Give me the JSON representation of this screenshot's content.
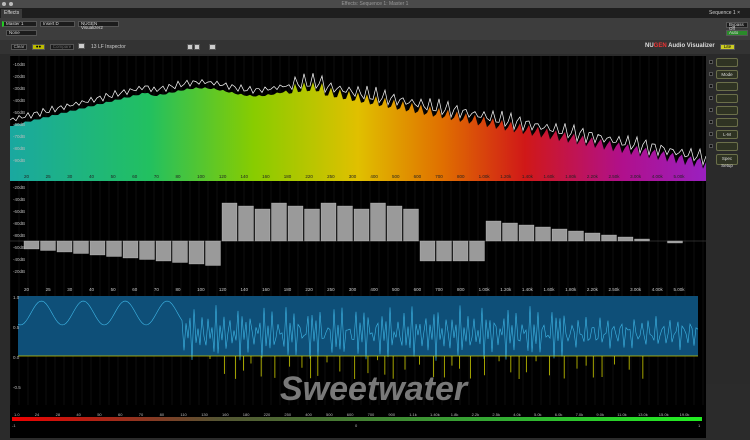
{
  "window": {
    "title": "Effects: Sequence 1: Master 1"
  },
  "tabs": {
    "effects": "Effects",
    "sequence": "Sequence 1 ×"
  },
  "controls": {
    "track": "Master 1",
    "insert": "Insert D",
    "plugin": "NUGEN Visualizer2",
    "preset": "None",
    "bypass": "Bypass Off",
    "auto": "Auto"
  },
  "toolbar": {
    "clear": "Clear",
    "link": "●●",
    "compare": "Compare",
    "inspector": "13 LF Inspector",
    "brand_nu": "NU",
    "brand_gen": "GEN",
    "brand_rest": " Audio Visualizer",
    "lite": "Lite"
  },
  "spectrum": {
    "db_labels": [
      "-10dB",
      "-20dB",
      "-30dB",
      "-40dB",
      "-50dB",
      "-60dB",
      "-70dB",
      "-80dB",
      "-90dB"
    ]
  },
  "bands": {
    "db_labels": [
      "-20dB",
      "-40dB",
      "-60dB",
      "-80dB",
      "-80dB",
      "-60dB",
      "-40dB",
      "-20dB"
    ]
  },
  "phase": {
    "labels": [
      "1.0",
      "0.5",
      "0.0",
      "-0.5"
    ]
  },
  "freq_labels": [
    "20",
    "25",
    "30",
    "40",
    "50",
    "60",
    "70",
    "80",
    "100",
    "120",
    "140",
    "160",
    "180",
    "220",
    "250",
    "300",
    "400",
    "500",
    "600",
    "700",
    "800",
    "1.00k",
    "1.20k",
    "1.40k",
    "1.60k",
    "1.80k",
    "2.20k",
    "2.50k",
    "3.00k",
    "4.00k",
    "5.00k"
  ],
  "meter_labels": [
    "1.0",
    "24",
    "28",
    "40",
    "50",
    "60",
    "70",
    "80",
    "110",
    "130",
    "160",
    "180",
    "220",
    "250",
    "400",
    "500",
    "600",
    "700",
    "900",
    "1.1k",
    "1.40k",
    "1.8k",
    "2.2k",
    "2.5k",
    "4.0k",
    "5.0k",
    "6.0k",
    "7.0k",
    "9.0k",
    "11.0k",
    "13.0k",
    "15.0k",
    "19.0k"
  ],
  "meter_ticks": [
    "-1",
    "0",
    "1"
  ],
  "watermark": "Sweetwater",
  "side_buttons": [
    "",
    "Mode",
    "",
    "",
    "",
    "",
    "L-M",
    "",
    "Spec Setup"
  ]
}
